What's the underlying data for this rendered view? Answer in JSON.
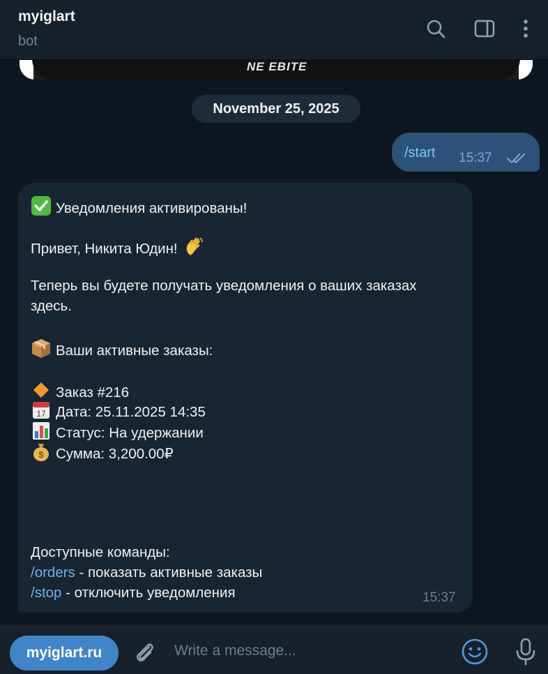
{
  "header": {
    "title": "myiglart",
    "subtitle": "bot",
    "icons": [
      "search-icon",
      "sidebar-toggle-icon",
      "more-vertical-icon"
    ]
  },
  "media": {
    "caption": "NE EBITE"
  },
  "date_separator": "November 25, 2025",
  "outgoing": {
    "text": "/start",
    "time": "15:37",
    "status": "read"
  },
  "incoming": {
    "line1": "Уведомления активированы!",
    "line2": "Привет, Никита Юдин!",
    "line3a": "Теперь вы будете получать уведомления о ваших заказах",
    "line3b": "здесь.",
    "line4": "Ваши активные заказы:",
    "order": "Заказ #216",
    "date": "Дата: 25.11.2025 14:35",
    "status": "Статус: На удержании",
    "sum": "Сумма: 3,200.00₽",
    "commands_title": "Доступные команды:",
    "cmd1": "/orders",
    "cmd1_desc": " - показать активные заказы",
    "cmd2": "/stop",
    "cmd2_desc": " - отключить уведомления",
    "time": "15:37"
  },
  "composer": {
    "site_button": "myiglart.ru",
    "placeholder": "Write a message..."
  },
  "colors": {
    "background": "#0e1621",
    "header": "#17212b",
    "incoming_bubble": "#182533",
    "outgoing_bubble": "#2b5278",
    "link": "#6ab3f3",
    "button": "#3e86c9"
  }
}
